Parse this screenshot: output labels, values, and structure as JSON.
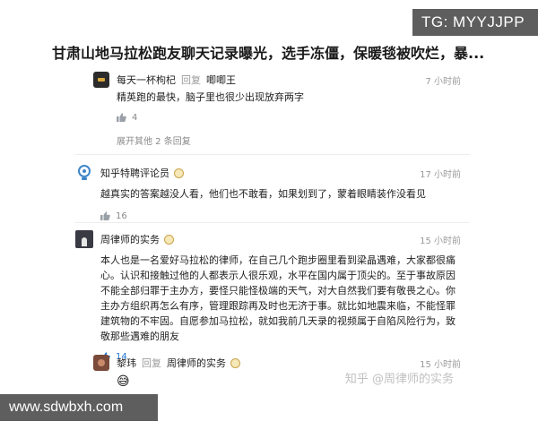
{
  "watermark_tg": "TG: MYYJJPP",
  "headline": "甘肃山地马拉松跑友聊天记录曝光，选手冻僵，保暖毯被吹烂，暴...",
  "reply1": {
    "user": "每天一杯枸杞",
    "reply_word": "回复",
    "to_user": "唧唧王",
    "time": "7 小时前",
    "text": "精英跑的最快，脑子里也很少出现放弃两字",
    "likes": "4",
    "expand": "展开其他 2 条回复"
  },
  "comment1": {
    "user": "知乎特聘评论员",
    "time": "17 小时前",
    "text": "越真实的答案越没人看，他们也不敢看，如果划到了，蒙着眼睛装作没看见",
    "likes": "16"
  },
  "comment2": {
    "user": "周律师的实务",
    "time": "15 小时前",
    "text": "本人也是一名爱好马拉松的律师，在自己几个跑步圈里看到梁晶遇难，大家都很痛心。认识和接触过他的人都表示人很乐观，水平在国内属于顶尖的。至于事故原因不能全部归罪于主办方，要怪只能怪极端的天气，对大自然我们要有敬畏之心。你主办方组织再怎么有序，管理跟踪再及时也无济于事。就比如地震来临，不能怪罪建筑物的不牢固。自愿参加马拉松，就如我前几天录的视频属于自陷风险行为，致敬那些遇难的朋友",
    "likes": "14"
  },
  "reply2": {
    "user": "黎玮",
    "reply_word": "回复",
    "to_user": "周律师的实务",
    "time": "15 小时前",
    "emoji": "😅"
  },
  "zhihu_watermark": "知乎 @周律师的实务",
  "watermark_site": "www.sdwbxh.com",
  "colors": {
    "like_blue": "#1e73d8",
    "muted": "#9a9a9a",
    "watermark_bg": "#5e5e5e"
  }
}
